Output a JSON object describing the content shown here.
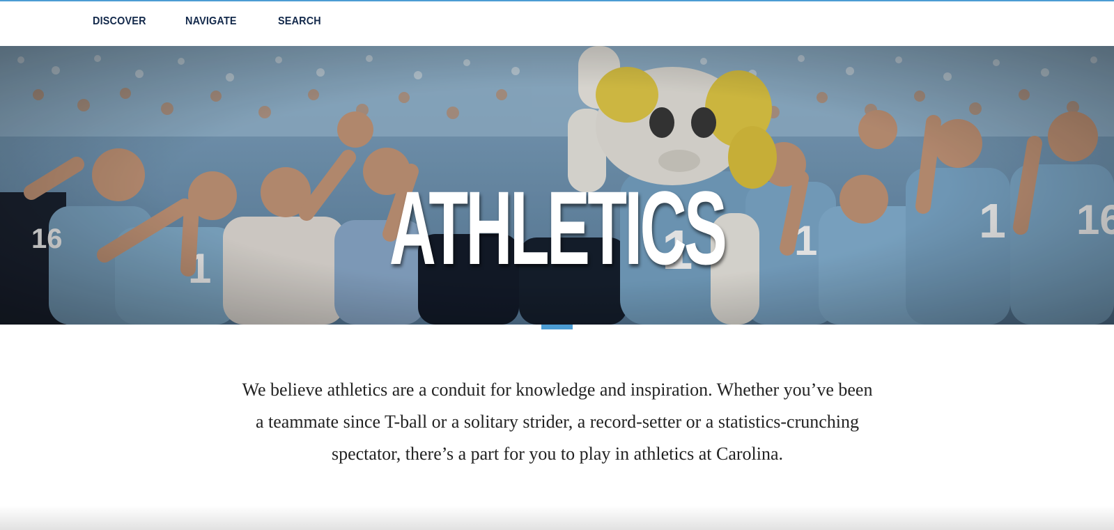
{
  "nav": {
    "items": [
      {
        "label": "DISCOVER"
      },
      {
        "label": "NAVIGATE"
      },
      {
        "label": "SEARCH"
      }
    ]
  },
  "hero": {
    "title": "ATHLETICS",
    "image": "crowd-of-fans-with-ram-mascot"
  },
  "intro": {
    "text": "We believe athletics are a conduit for knowledge and inspiration. Whether you’ve been a teammate since T-ball or a solitary strider, a record-setter or a statistics-crunching spectator, there’s a part for you to play in athletics at Carolina."
  },
  "colors": {
    "accent": "#4b9cd3",
    "navy": "#13294b",
    "carolina_blue": "#7bafd4"
  }
}
